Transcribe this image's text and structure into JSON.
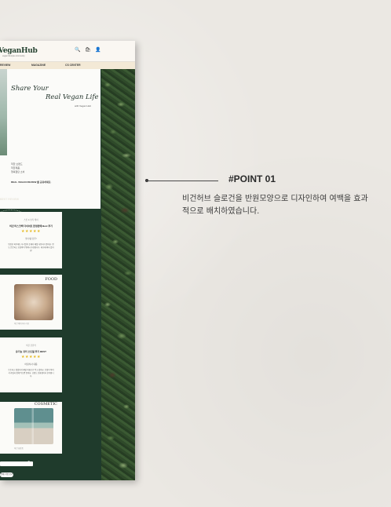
{
  "site": {
    "logo": "VeganHub",
    "logo_sub": "vegan lifestyle community",
    "header_icons": "🔍 🛍 👤",
    "nav": [
      "REVIEW",
      "MAGAZINE",
      "CS CENTER"
    ]
  },
  "hero": {
    "line1": "Share    Your",
    "line2": "Real Vegan Life",
    "byline": "with Vegan Hub",
    "small_text": [
      "착한 브랜드",
      "착한제품,",
      "행복했던 소비"
    ],
    "bold_text": "REAL VEGAN REVIEW 를 공유하세요."
  },
  "section": {
    "title": "BEST REVIEW"
  },
  "cards": [
    {
      "small_title": "스킨 & 뷰티 케어",
      "title": "비건 마스크팩 다이어트 한정판매 Best 후기",
      "stars": "★★★★★",
      "sub": "필수템 강추!",
      "body": "민감한 피부에도 자극없이 순해서 매일 사용하기 좋아요. 향도 은은하고 보습력이 뛰어나 추천합니다. 재구매 의사 있어요!"
    },
    {
      "category": "FOOD",
      "caption": "비건 베이커리 리뷰"
    },
    {
      "small_title": "비건 간편식",
      "title": "유기농 귀리 오트밀 후기 BEST",
      "stars": "★★★★★",
      "sub": "아침식사 대용",
      "body": "든든하고 맛있어서 매일 아침으로 먹고 있어요. 단맛이 적어서 과일과 함께 먹으면 좋아요. 포장도 친환경이라 만족합니다."
    },
    {
      "category": "COSMETIC",
      "caption": "비건 화장품"
    }
  ],
  "footer": {
    "pill": "전체 리뷰 보기"
  },
  "annotation": {
    "title": "#POINT 01",
    "description": "비건허브 슬로건을 반원모양으로 디자인하여 여백을 효과적으로 배치하였습니다."
  }
}
